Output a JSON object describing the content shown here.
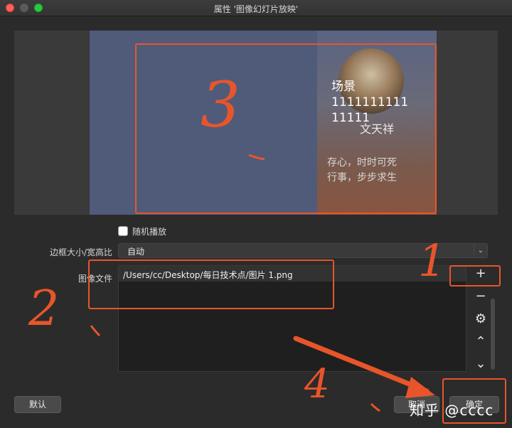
{
  "window": {
    "title": "属性 '图像幻灯片放映'"
  },
  "preview": {
    "scene_text": [
      "场景",
      "1111111111",
      "11111"
    ],
    "slide_name": "文天祥",
    "slide_poem": [
      "存心，时时可死",
      "行事，步步求生"
    ]
  },
  "form": {
    "random_label": "随机播放",
    "border_label": "边框大小/宽高比",
    "border_value": "自动",
    "images_label": "图像文件",
    "file_path": "/Users/cc/Desktop/每日技术点/图片 1.png"
  },
  "buttons": {
    "default": "默认",
    "cancel": "取消",
    "ok": "确定"
  },
  "annotations": {
    "n1": "1",
    "n2": "2",
    "n3": "3",
    "n4": "4"
  },
  "watermark": "知乎 @cccc",
  "colors": {
    "annotation": "#e8552b",
    "slide_blue": "#4f5b79"
  }
}
